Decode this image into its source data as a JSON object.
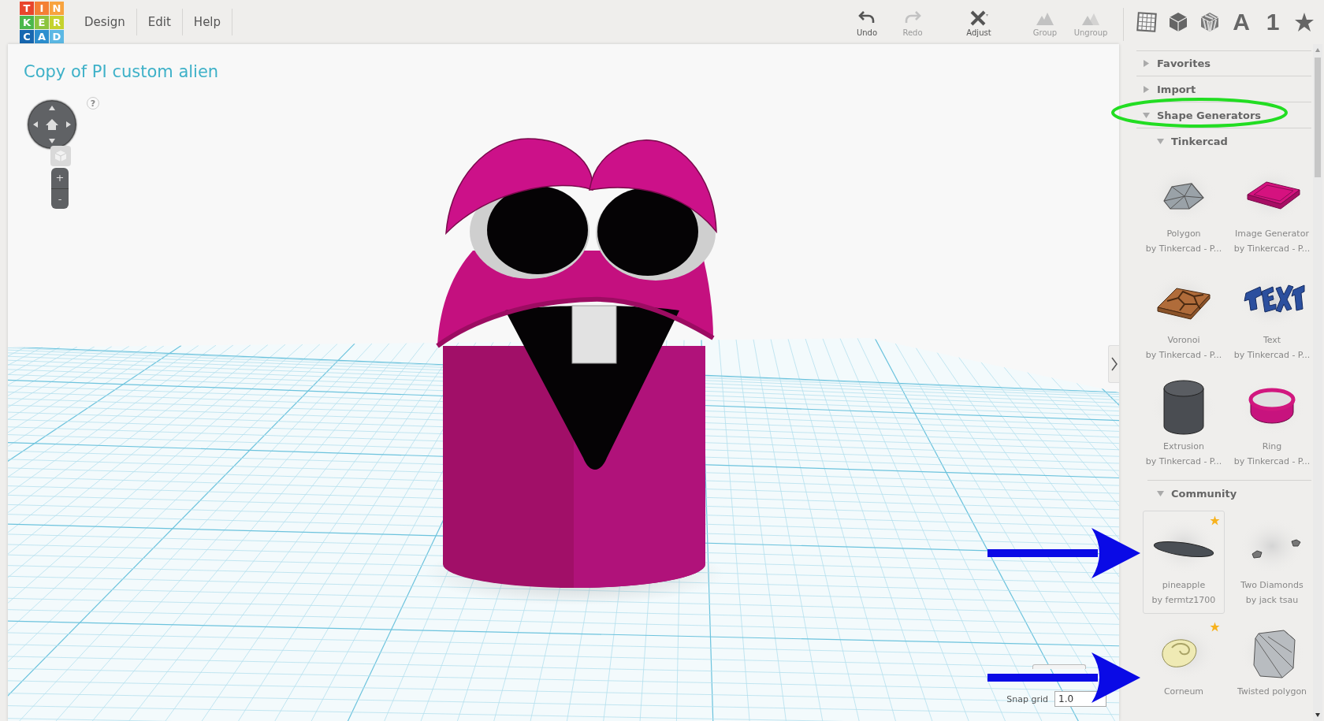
{
  "logo": {
    "tiles": [
      {
        "letter": "T",
        "color": "#e8452c"
      },
      {
        "letter": "I",
        "color": "#f47f35"
      },
      {
        "letter": "N",
        "color": "#f8a33e"
      },
      {
        "letter": "K",
        "color": "#4bb84b"
      },
      {
        "letter": "E",
        "color": "#8dc43f"
      },
      {
        "letter": "R",
        "color": "#c5d22e"
      },
      {
        "letter": "C",
        "color": "#1767b0"
      },
      {
        "letter": "A",
        "color": "#2d8fcf"
      },
      {
        "letter": "D",
        "color": "#5cb8e4"
      }
    ]
  },
  "menu": [
    {
      "label": "Design"
    },
    {
      "label": "Edit"
    },
    {
      "label": "Help"
    }
  ],
  "toolbar": [
    {
      "kind": "undo",
      "label": "Undo",
      "disabled": false
    },
    {
      "kind": "redo",
      "label": "Redo",
      "disabled": true
    },
    {
      "kind": "adjust",
      "label": "Adjust",
      "disabled": false
    },
    {
      "kind": "group",
      "label": "Group",
      "disabled": true
    },
    {
      "kind": "ungroup",
      "label": "Ungroup",
      "disabled": true
    }
  ],
  "shape_tools": [
    {
      "kind": "grid"
    },
    {
      "kind": "box"
    },
    {
      "kind": "hole"
    },
    {
      "kind": "glyph",
      "label": "A"
    },
    {
      "kind": "glyph",
      "label": "1"
    },
    {
      "kind": "star"
    }
  ],
  "viewport": {
    "title": "Copy of PI custom alien",
    "help": "?",
    "zoom_in": "+",
    "zoom_out": "-",
    "snap_grid": {
      "label": "Snap grid",
      "value": "1.0"
    }
  },
  "library": {
    "sections": [
      {
        "label": "Favorites",
        "expanded": false
      },
      {
        "label": "Import",
        "expanded": false
      },
      {
        "label": "Shape Generators",
        "expanded": true,
        "children": [
          {
            "label": "Tinkercad",
            "expanded": true,
            "shapes": [
              {
                "kind": "polygon",
                "name": "Polygon",
                "author": "by Tinkercad - P...",
                "starred": false,
                "selected": false
              },
              {
                "kind": "plate",
                "name": "Image Generator",
                "author": "by Tinkercad - P...",
                "starred": false,
                "selected": false
              },
              {
                "kind": "voronoi",
                "name": "Voronoi",
                "author": "by Tinkercad - P...",
                "starred": false,
                "selected": false
              },
              {
                "kind": "text",
                "name": "Text",
                "author": "by Tinkercad - P...",
                "starred": false,
                "selected": false
              },
              {
                "kind": "cylinder",
                "name": "Extrusion",
                "author": "by Tinkercad - P...",
                "starred": false,
                "selected": false
              },
              {
                "kind": "ring",
                "name": "Ring",
                "author": "by Tinkercad - P...",
                "starred": false,
                "selected": false
              }
            ]
          },
          {
            "label": "Community",
            "expanded": true,
            "shapes": [
              {
                "kind": "ellipsoid",
                "name": "pineapple",
                "author": "by fermtz1700",
                "starred": true,
                "selected": true
              },
              {
                "kind": "diamonds",
                "name": "Two Diamonds",
                "author": "by jack tsau",
                "starred": false,
                "selected": false
              },
              {
                "kind": "shell",
                "name": "Corneum",
                "starred": true,
                "selected": false
              },
              {
                "kind": "twisted",
                "name": "Twisted polygon",
                "starred": false,
                "selected": false
              }
            ]
          }
        ]
      }
    ]
  },
  "annotations": [
    {
      "kind": "ellipse",
      "color": "#22dd22"
    },
    {
      "kind": "arrow",
      "color": "#0a0ae6"
    },
    {
      "kind": "arrow",
      "color": "#0a0ae6"
    }
  ]
}
